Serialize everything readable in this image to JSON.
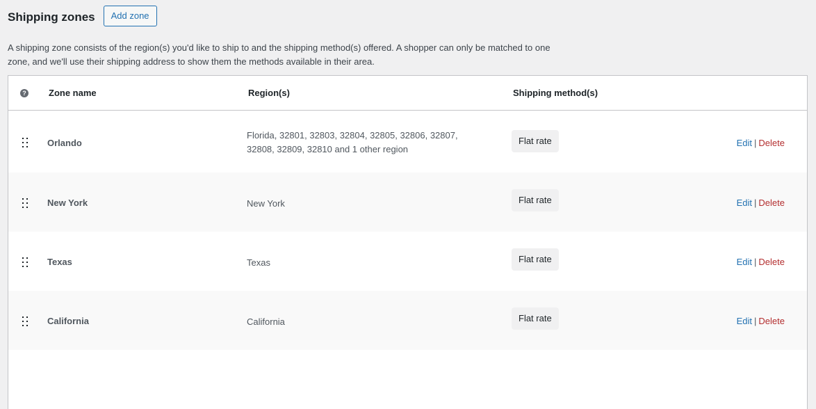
{
  "header": {
    "title": "Shipping zones",
    "add_zone_label": "Add zone"
  },
  "description": "A shipping zone consists of the region(s) you'd like to ship to and the shipping method(s) offered. A shopper can only be matched to one zone, and we'll use their shipping address to show them the methods available in their area.",
  "table": {
    "help_icon": "?",
    "columns": {
      "zone_name": "Zone name",
      "regions": "Region(s)",
      "methods": "Shipping method(s)"
    },
    "rows": [
      {
        "zone_name": "Orlando",
        "regions": "Florida, 32801, 32803, 32804, 32805, 32806, 32807, 32808, 32809, 32810 and 1 other region",
        "method": "Flat rate",
        "edit_label": "Edit",
        "separator": "|",
        "delete_label": "Delete"
      },
      {
        "zone_name": "New York",
        "regions": "New York",
        "method": "Flat rate",
        "edit_label": "Edit",
        "separator": "|",
        "delete_label": "Delete"
      },
      {
        "zone_name": "Texas",
        "regions": "Texas",
        "method": "Flat rate",
        "edit_label": "Edit",
        "separator": "|",
        "delete_label": "Delete"
      },
      {
        "zone_name": "California",
        "regions": "California",
        "method": "Flat rate",
        "edit_label": "Edit",
        "separator": "|",
        "delete_label": "Delete"
      }
    ]
  },
  "colors": {
    "link": "#2271b1",
    "delete": "#b32d2e",
    "background": "#f0f0f1"
  }
}
